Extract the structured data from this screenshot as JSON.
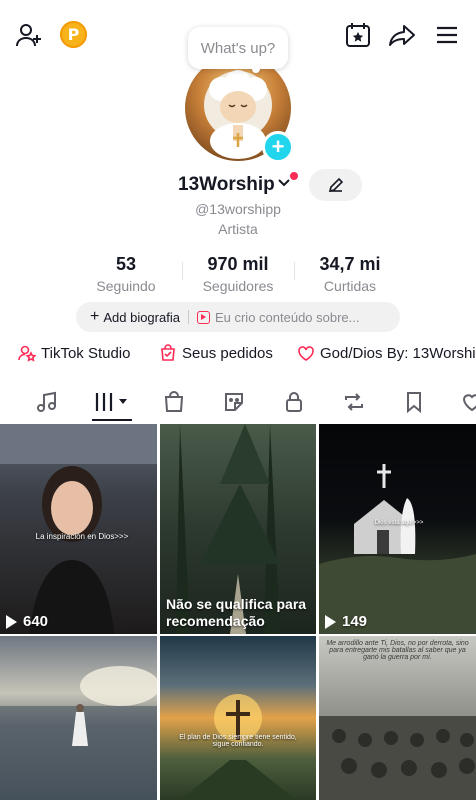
{
  "top_bar": {
    "add_friend_icon": "person-plus-icon",
    "coin_label": "P",
    "calendar_icon": "calendar-star-icon",
    "share_icon": "share-arrow-icon",
    "menu_icon": "hamburger-menu-icon"
  },
  "status_bubble": "What's up?",
  "profile": {
    "username": "13Worship",
    "handle": "@13worshipp",
    "category": "Artista"
  },
  "stats": [
    {
      "value": "53",
      "label": "Seguindo"
    },
    {
      "value": "970 mil",
      "label": "Seguidores"
    },
    {
      "value": "34,7 mi",
      "label": "Curtidas"
    }
  ],
  "bio": {
    "add_label": "Add biografia",
    "promo_text": "Eu crio conteúdo sobre..."
  },
  "links": [
    {
      "label": "TikTok Studio",
      "icon": "studio-icon"
    },
    {
      "label": "Seus pedidos",
      "icon": "orders-bag-icon"
    },
    {
      "label": "God/Dios By: 13Worship",
      "icon": "sticker-heart-icon"
    }
  ],
  "tabs": [
    {
      "name": "music",
      "icon": "music-note-icon"
    },
    {
      "name": "videos",
      "icon": "grid-bars-icon",
      "selected": true
    },
    {
      "name": "shop",
      "icon": "shopping-bag-icon"
    },
    {
      "name": "stickers",
      "icon": "sticker-icon"
    },
    {
      "name": "private",
      "icon": "lock-icon"
    },
    {
      "name": "reposts",
      "icon": "repost-icon"
    },
    {
      "name": "favorites",
      "icon": "bookmark-icon"
    },
    {
      "name": "liked",
      "icon": "heart-icon"
    }
  ],
  "videos": [
    {
      "views": "640",
      "caption": "La inspiración en Dios>>>"
    },
    {
      "views": "",
      "caption": "",
      "overlay": "Não se qualifica para recomendação"
    },
    {
      "views": "149",
      "caption": "Dios está aquí>>>"
    },
    {
      "views": "",
      "caption": ""
    },
    {
      "views": "",
      "caption": "El plan de Dios siempre tiene sentido, sigue confiando."
    },
    {
      "views": "",
      "caption": "Me arrodillo ante Ti, Dios, no por derrota, sino para entregarte mis batallas al saber que ya ganó la guerra por mí."
    }
  ]
}
